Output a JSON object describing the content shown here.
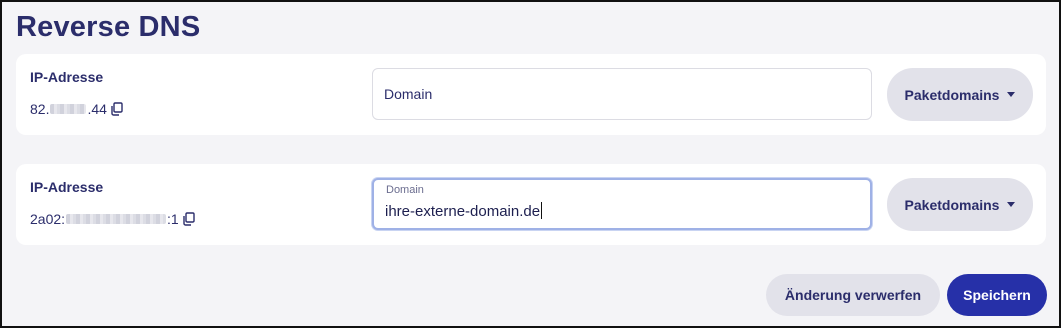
{
  "page": {
    "title": "Reverse DNS"
  },
  "entries": [
    {
      "ip_label": "IP-Adresse",
      "ip_prefix": "82.",
      "ip_suffix": ".44",
      "domain_placeholder": "Domain",
      "domain_value": "",
      "dropdown_label": "Paketdomains"
    },
    {
      "ip_label": "IP-Adresse",
      "ip_prefix": "2a02:",
      "ip_suffix": ":1",
      "domain_placeholder": "Domain",
      "domain_value": "ihre-externe-domain.de",
      "dropdown_label": "Paketdomains"
    }
  ],
  "actions": {
    "discard_label": "Änderung verwerfen",
    "save_label": "Speichern"
  },
  "icons": {
    "copy": "copy-icon",
    "dropdown": "chevron-down-icon"
  },
  "colors": {
    "title": "#2b2d6b",
    "primary": "#2630a8",
    "pill_bg": "#e2e2ea",
    "background": "#f4f4f7",
    "focus_border": "#9fb1e6"
  }
}
